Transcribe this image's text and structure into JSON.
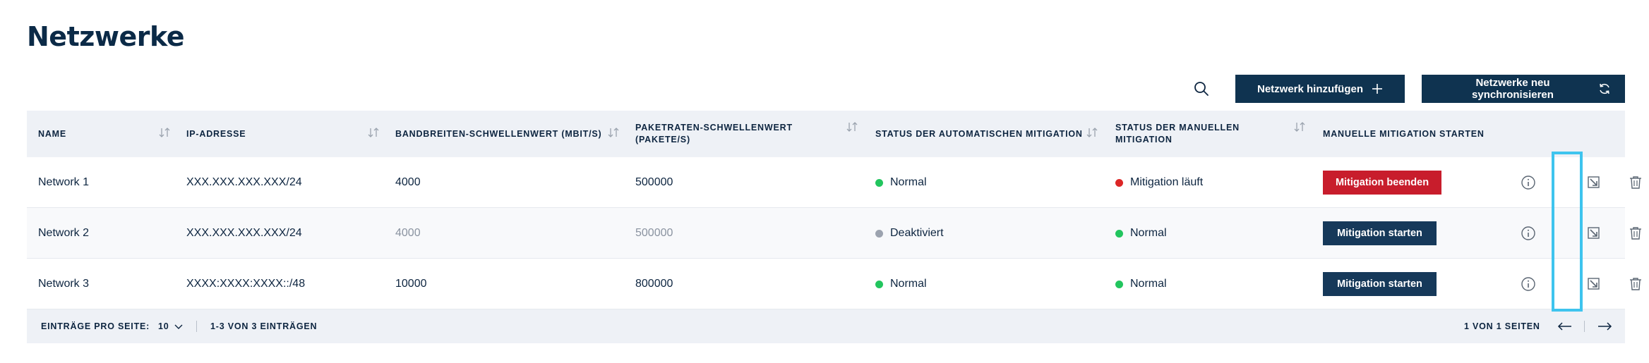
{
  "page": {
    "title": "Netzwerke"
  },
  "toolbar": {
    "search_icon": "search-icon",
    "add_label": "Netzwerk hinzufügen",
    "add_icon": "plus-icon",
    "sync_label": "Netzwerke neu synchronisieren",
    "sync_icon": "refresh-icon"
  },
  "table": {
    "columns": [
      {
        "label": "Name",
        "sortable": true
      },
      {
        "label": "IP-Adresse",
        "sortable": true
      },
      {
        "label": "Bandbreiten-Schwellenwert (Mbit/s)",
        "sortable": true
      },
      {
        "label": "Paketraten-Schwellenwert (Pakete/s)",
        "sortable": true
      },
      {
        "label": "Status der automatischen Mitigation",
        "sortable": true
      },
      {
        "label": "Status der manuellen Mitigation",
        "sortable": true
      },
      {
        "label": "Manuelle Mitigation starten",
        "sortable": false
      }
    ],
    "rows": [
      {
        "name": "Network 1",
        "ip": "XXX.XXX.XXX.XXX/24",
        "bandwidth": "4000",
        "packet_rate": "500000",
        "auto_status": "Normal",
        "auto_status_color": "#22c55e",
        "manual_status": "Mitigation läuft",
        "manual_status_color": "#dc2626",
        "action_label": "Mitigation beenden",
        "action_color": "#c81d2c"
      },
      {
        "name": "Network 2",
        "ip": "XXX.XXX.XXX.XXX/24",
        "bandwidth": "4000",
        "packet_rate": "500000",
        "auto_status": "Deaktiviert",
        "auto_status_color": "#9ca3af",
        "manual_status": "Normal",
        "manual_status_color": "#22c55e",
        "action_label": "Mitigation starten",
        "action_color": "#16395a"
      },
      {
        "name": "Network 3",
        "ip": "XXXX:XXXX:XXXX::/48",
        "bandwidth": "10000",
        "packet_rate": "800000",
        "auto_status": "Normal",
        "auto_status_color": "#22c55e",
        "manual_status": "Normal",
        "manual_status_color": "#22c55e",
        "action_label": "Mitigation starten",
        "action_color": "#16395a"
      }
    ],
    "row_icons": [
      "info-icon",
      "edit-icon",
      "trash-icon"
    ]
  },
  "footer": {
    "per_page_label": "Einträge pro Seite:",
    "per_page_value": "10",
    "range_text": "1-3 von 3 Einträgen",
    "page_text": "1 von 1 Seiten",
    "prev_icon": "arrow-left-icon",
    "next_icon": "arrow-right-icon"
  },
  "colors": {
    "primary": "#0f3350",
    "header_bg": "#eef1f6",
    "danger": "#c81d2c",
    "highlight": "#3ec4ee"
  }
}
